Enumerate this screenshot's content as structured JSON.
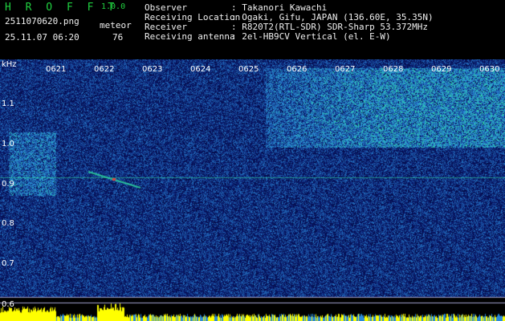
{
  "app": {
    "name": "H R O F F T",
    "version": "1.0.0"
  },
  "file": {
    "name": "2511070620.png",
    "datetime": "25.11.07 06:20"
  },
  "meteor": {
    "label": "meteor",
    "count": "76"
  },
  "info": [
    {
      "label": "Observer",
      "value": ": Takanori Kawachi"
    },
    {
      "label": "Receiving Location",
      "value": ": Ogaki, Gifu, JAPAN (136.60E, 35.35N)"
    },
    {
      "label": "Receiver",
      "value": ": R820T2(RTL-SDR) SDR-Sharp 53.372MHz"
    },
    {
      "label": "Receiving antenna",
      "value": ": 2el-HB9CV Vertical (el. E-W)"
    }
  ],
  "spectrogram": {
    "y_unit": "kHz",
    "y_ticks": [
      "1.1",
      "1.0",
      "0.9",
      "0.8",
      "0.7",
      "0.6"
    ],
    "time_ticks": [
      "0621",
      "0622",
      "0623",
      "0624",
      "0625",
      "0626",
      "0627",
      "0628",
      "0629",
      "0630"
    ],
    "colors": {
      "low": "#0a1a6e",
      "mid": "#2a8ad8",
      "high": "#30e0a0",
      "peak": "#e04040",
      "level": "#ffff00"
    }
  }
}
